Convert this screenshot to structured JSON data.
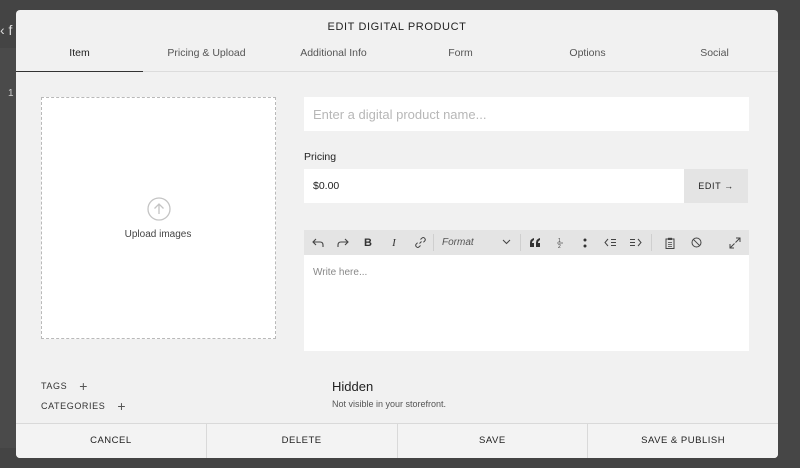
{
  "background": {
    "back_glyph": "‹ f",
    "left_number": "1"
  },
  "modal": {
    "title": "EDIT DIGITAL PRODUCT",
    "tabs": [
      {
        "label": "Item",
        "active": true
      },
      {
        "label": "Pricing & Upload",
        "active": false
      },
      {
        "label": "Additional Info",
        "active": false
      },
      {
        "label": "Form",
        "active": false
      },
      {
        "label": "Options",
        "active": false
      },
      {
        "label": "Social",
        "active": false
      }
    ]
  },
  "upload": {
    "label": "Upload images",
    "icon": "arrow-up-circle-icon"
  },
  "product": {
    "name_value": "",
    "name_placeholder": "Enter a digital product name..."
  },
  "pricing": {
    "label": "Pricing",
    "value": "$0.00",
    "edit_label": "EDIT →"
  },
  "editor": {
    "toolbar": {
      "undo": "undo-icon",
      "redo": "redo-icon",
      "bold": "B",
      "italic": "I",
      "link": "link-icon",
      "format_label": "Format",
      "quote": "quote-icon",
      "ordered_list": "ordered-list-icon",
      "bullet_list": "bullet-list-icon",
      "outdent": "outdent-icon",
      "indent": "indent-icon",
      "paste": "clipboard-icon",
      "clear": "clear-format-icon",
      "expand": "expand-icon"
    },
    "placeholder": "Write here..."
  },
  "meta": {
    "tags_label": "TAGS",
    "categories_label": "CATEGORIES",
    "plus": "+"
  },
  "visibility": {
    "title": "Hidden",
    "subtitle": "Not visible in your storefront."
  },
  "footer": {
    "cancel": "CANCEL",
    "delete": "DELETE",
    "save": "SAVE",
    "save_publish": "SAVE & PUBLISH"
  }
}
